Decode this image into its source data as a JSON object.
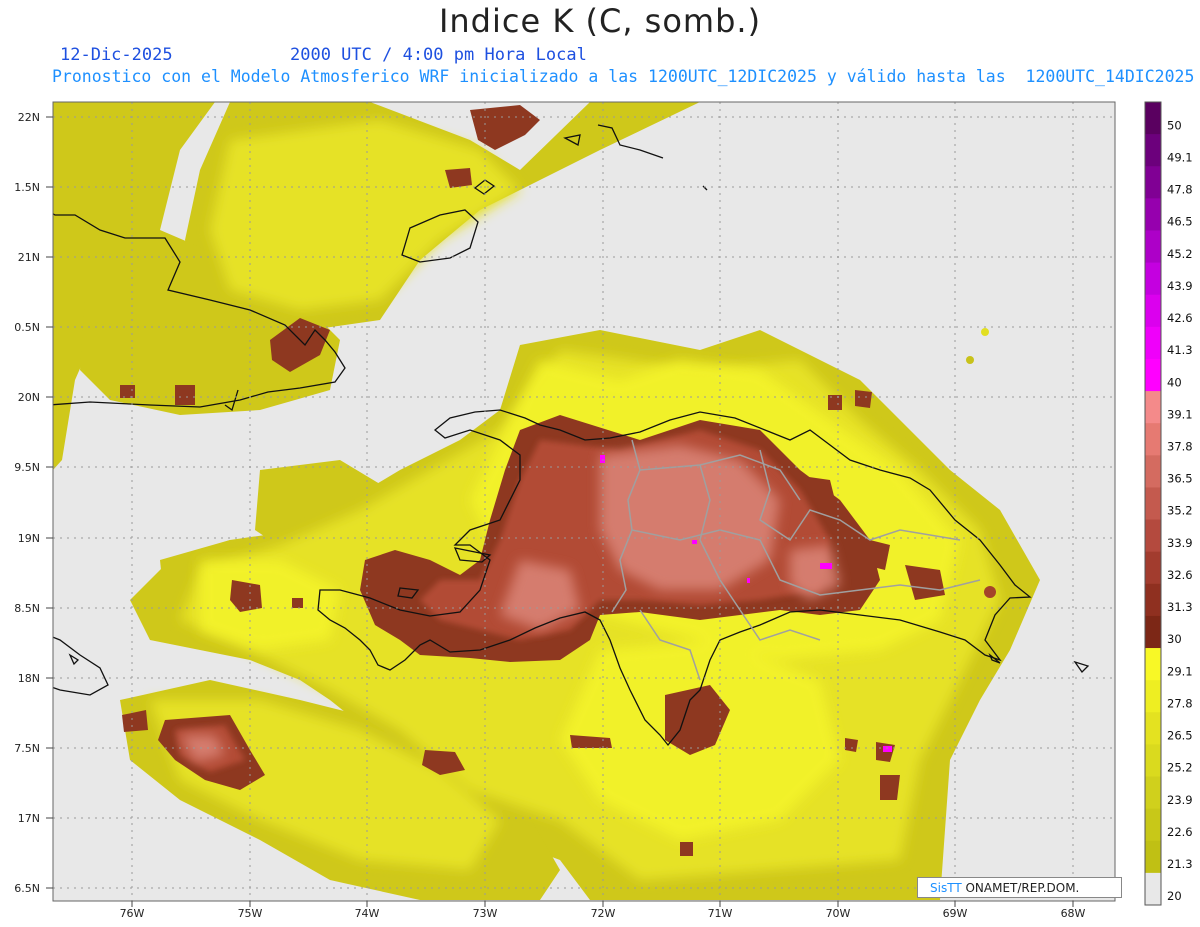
{
  "header": {
    "title": "Indice K (C, somb.)",
    "date": "12-Dic-2025",
    "time": "2000 UTC / 4:00 pm Hora Local",
    "model_line": "Pronostico con el Modelo Atmosferico WRF inicializado a las 1200UTC_12DIC2025 y válido hasta las  1200UTC_14DIC2025"
  },
  "map": {
    "lat_labels": [
      "22N",
      "1.5N",
      "21N",
      "0.5N",
      "20N",
      "9.5N",
      "19N",
      "8.5N",
      "18N",
      "7.5N",
      "17N",
      "6.5N"
    ],
    "lon_labels": [
      "76W",
      "75W",
      "74W",
      "73W",
      "72W",
      "71W",
      "70W",
      "69W",
      "68W"
    ],
    "colors": {
      "background_no_data": "#e8e8e8",
      "yellow_low": "#c7bf12",
      "yellow_mid": "#dcdc22",
      "yellow_high": "#f5f52a",
      "brown_dark": "#8b3a1f",
      "brown_mid": "#b04a33",
      "brown_light": "#d77c6f",
      "magenta": "#ff00ff",
      "coast": "#111111",
      "borders": "#999999",
      "grid": "#9a9a9a"
    }
  },
  "colorbar": {
    "labels": [
      "50",
      "49.1",
      "47.8",
      "46.5",
      "45.2",
      "43.9",
      "42.6",
      "41.3",
      "40",
      "39.1",
      "37.8",
      "36.5",
      "35.2",
      "33.9",
      "32.6",
      "31.3",
      "30",
      "29.1",
      "27.8",
      "26.5",
      "25.2",
      "23.9",
      "22.6",
      "21.3",
      "20"
    ],
    "colors": [
      "#5a0060",
      "#6c007c",
      "#800094",
      "#9600ae",
      "#ad00c8",
      "#c400e0",
      "#db00ee",
      "#ef00fa",
      "#ff00ff",
      "#f48a8a",
      "#e67a72",
      "#d46b60",
      "#c45a4e",
      "#b44a3e",
      "#a23c2e",
      "#8f3020",
      "#7c2716",
      "#f8f826",
      "#eeee22",
      "#e4e220",
      "#dada1e",
      "#d0d01c",
      "#c8c818",
      "#c0c014",
      "#e8e8e8"
    ]
  },
  "credit": {
    "brand": "SisTT",
    "text": " ONAMET/REP.DOM."
  }
}
